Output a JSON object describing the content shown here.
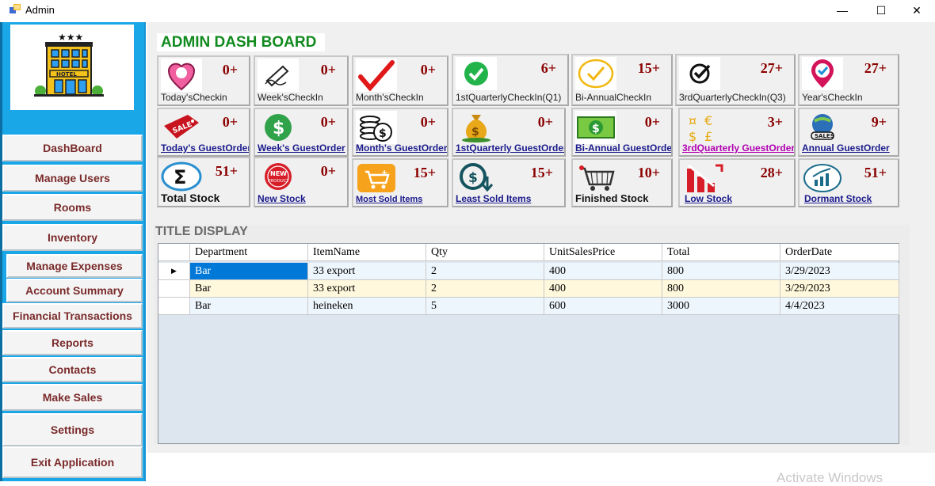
{
  "window": {
    "title": "Admin",
    "minimize_glyph": "—",
    "maximize_glyph": "☐",
    "close_glyph": "✕"
  },
  "sidebar": {
    "items": [
      {
        "label": "DashBoard"
      },
      {
        "label": "Manage Users"
      },
      {
        "label": "Rooms"
      },
      {
        "label": "Inventory"
      },
      {
        "label": "Manage Expenses"
      },
      {
        "label": "Account Summary"
      },
      {
        "label": "Financial Transactions"
      },
      {
        "label": "Reports"
      },
      {
        "label": "Contacts"
      },
      {
        "label": "Make Sales"
      },
      {
        "label": "Settings"
      },
      {
        "label": "Exit Application"
      }
    ]
  },
  "dashboard": {
    "title": "ADMIN DASH BOARD",
    "tiles": [
      {
        "label": "Today'sCheckin",
        "count": "0+",
        "icon": "pink-heart-pin-icon"
      },
      {
        "label": "Week'sCheckIn",
        "count": "0+",
        "icon": "signature-pen-icon"
      },
      {
        "label": "Month'sCheckIn",
        "count": "0+",
        "icon": "red-checkmark-icon"
      },
      {
        "label": "1stQuarterlyCheckIn(Q1)",
        "count": "6+",
        "icon": "green-check-circle-icon"
      },
      {
        "label": "Bi-AnnualCheckIn",
        "count": "15+",
        "icon": "yellow-check-circle-icon"
      },
      {
        "label": "3rdQuarterlyCheckIn(Q3)",
        "count": "27+",
        "icon": "black-check-circle-icon"
      },
      {
        "label": "Year'sCheckIn",
        "count": "27+",
        "icon": "red-check-pin-icon"
      },
      {
        "label": "Today's GuestOrder",
        "count": "0+",
        "icon": "sale-tag-icon"
      },
      {
        "label": "Week's GuestOrder",
        "count": "0+",
        "icon": "dollar-coin-icon"
      },
      {
        "label": "Month's GuestOrder",
        "count": "0+",
        "icon": "coin-stack-icon"
      },
      {
        "label": "1stQuarterly GuestOrder",
        "count": "0+",
        "icon": "money-bag-icon"
      },
      {
        "label": "Bi-Annual GuestOrder",
        "count": "0+",
        "icon": "banknote-icon"
      },
      {
        "label": "3rdQuarterly GuestOrder",
        "count": "3+",
        "icon": "currency-symbols-icon"
      },
      {
        "label": "Annual GuestOrder",
        "count": "9+",
        "icon": "sales-globe-icon"
      },
      {
        "label": "Total Stock",
        "count": "51+",
        "icon": "sigma-icon"
      },
      {
        "label": "New Stock",
        "count": "0+",
        "icon": "new-product-badge-icon"
      },
      {
        "label": "Most Sold Items",
        "count": "15+",
        "icon": "shopping-cart-icon"
      },
      {
        "label": "Least Sold Items",
        "count": "15+",
        "icon": "dollar-down-arrow-icon"
      },
      {
        "label": "Finished Stock",
        "count": "10+",
        "icon": "empty-cart-icon"
      },
      {
        "label": "Low Stock",
        "count": "28+",
        "icon": "falling-chart-icon"
      },
      {
        "label": "Dormant Stock",
        "count": "51+",
        "icon": "growth-chart-circle-icon"
      }
    ]
  },
  "table": {
    "section_title": "TITLE DISPLAY",
    "columns": [
      "Department",
      "ItemName",
      "Qty",
      "UnitSalesPrice",
      "Total",
      "OrderDate"
    ],
    "rows": [
      [
        "Bar",
        "33 export",
        "2",
        "400",
        "800",
        "3/29/2023"
      ],
      [
        "Bar",
        "33 export",
        "2",
        "400",
        "800",
        "3/29/2023"
      ],
      [
        "Bar",
        "heineken",
        "5",
        "600",
        "3000",
        "4/4/2023"
      ]
    ],
    "current_row_marker": "▶"
  },
  "watermark": "Activate Windows",
  "colors": {
    "sidebar_bg": "#1aa7e8",
    "dash_title": "#118a1e",
    "count_text": "#8b0000",
    "selected_cell": "#0078d7",
    "alt_row": "#fff8dc",
    "row_bg": "#eef6fd"
  }
}
